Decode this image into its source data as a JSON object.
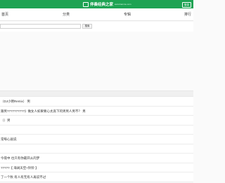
{
  "header": {
    "logo_text": "伴奏经典之家",
    "logo_sub": "www.banzou.com",
    "login_label": "登录"
  },
  "nav": {
    "items": [
      "首页",
      "分类",
      "专辑",
      "排行"
    ]
  },
  "search": {
    "placeholder": "",
    "button_label": "搜索"
  },
  "list": {
    "items": [
      "（DJ小明Remix） 男",
      "跟男??????????》做女人如果要心太高下的男男人男不？ 男",
      "（）男",
      "",
      "常每心居说",
      "",
      "今夜中 也只有你最开从的梦",
      "?????【 海阔天空+铃铃 】",
      "了一个秋 有人有无有人再说不过"
    ]
  }
}
